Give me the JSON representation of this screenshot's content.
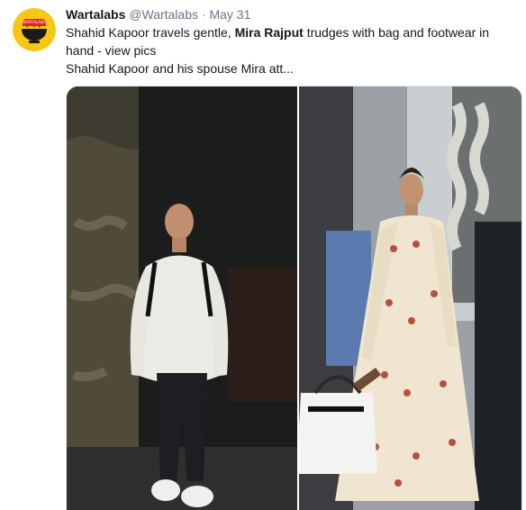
{
  "tweet": {
    "author_name": "Wartalabs",
    "author_handle": "@Wartalabs",
    "separator": "·",
    "date": "May 31",
    "avatar_text": "WARTALABS",
    "text_line1_before": "Shahid Kapoor travels gentle, ",
    "text_line1_bold": "Mira Rajput",
    "text_line1_after": " trudges with bag and footwear in hand - view pics",
    "text_line2": "Shahid Kapoor and his spouse Mira att..."
  },
  "colors": {
    "avatar_bg": "#f7c718",
    "avatar_red": "#e0261b",
    "name_text": "#14171a",
    "meta_text": "#657786"
  },
  "media": {
    "left_photo_icon": "photo-man-white-sweater",
    "right_photo_icon": "photo-woman-white-dress-with-bag"
  }
}
